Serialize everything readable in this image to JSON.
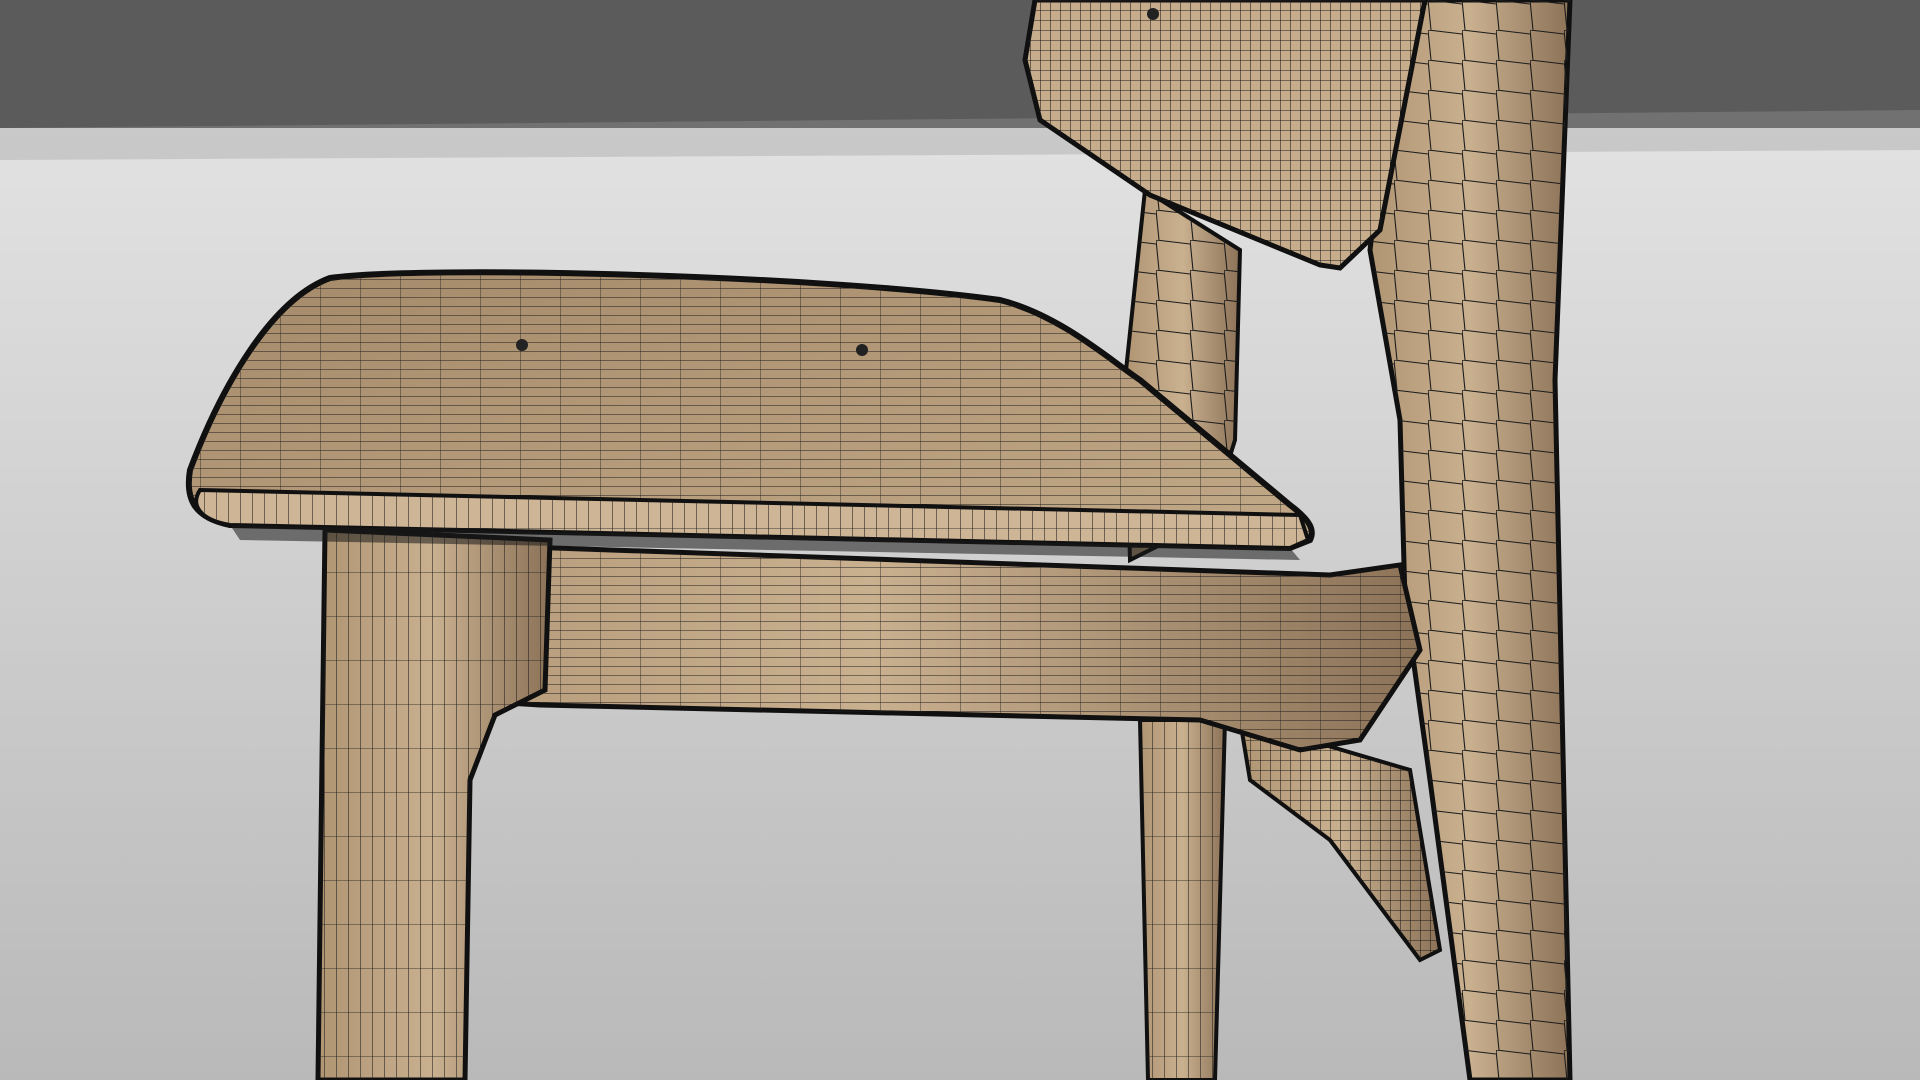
{
  "scene": {
    "subject": "wooden-chair-wireframe-render",
    "colors": {
      "backdrop_top": "#5b5b5b",
      "backdrop_floor_light": "#e2e2e2",
      "backdrop_floor_dark": "#b9b9b9",
      "wood_light": "#c9b08f",
      "wood_mid": "#b09573",
      "wood_dark": "#8c7257",
      "wire": "#1c1c1c",
      "edge": "#101010"
    }
  }
}
